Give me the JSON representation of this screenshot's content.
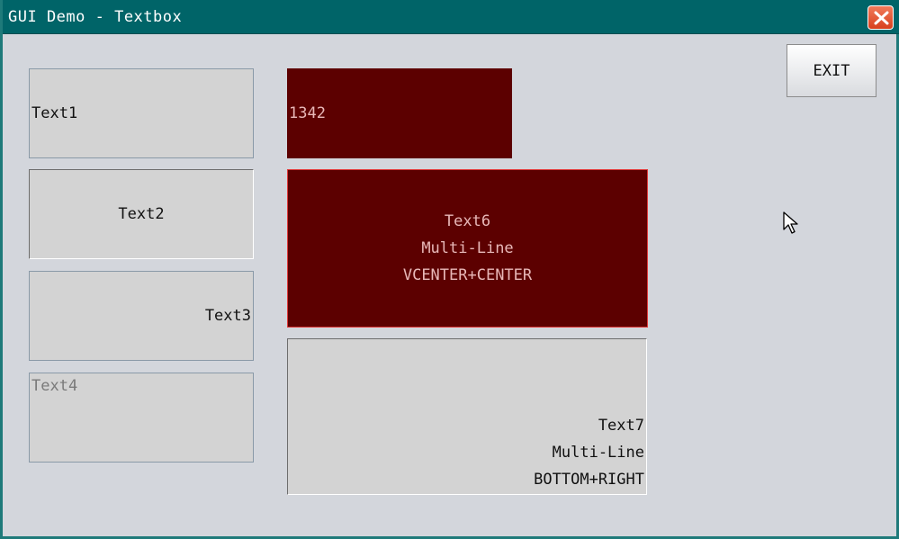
{
  "window": {
    "title": "GUI Demo - Textbox",
    "close_icon": "close-x-icon"
  },
  "textboxes": {
    "text1": "Text1",
    "text2": "Text2",
    "text3": "Text3",
    "text4": "Text4",
    "text5": "1342",
    "text6": "Text6\nMulti-Line\nVCENTER+CENTER",
    "text7": "Text7\nMulti-Line\nBOTTOM+RIGHT"
  },
  "buttons": {
    "exit_label": "EXIT"
  },
  "colors": {
    "titlebar": "#006468",
    "dark_box": "#5c0000",
    "dark_box_text": "#e8b8b8",
    "focus_border": "#e03a3a",
    "background": "#d3d6dc"
  },
  "pointer": "mouse-pointer-icon"
}
